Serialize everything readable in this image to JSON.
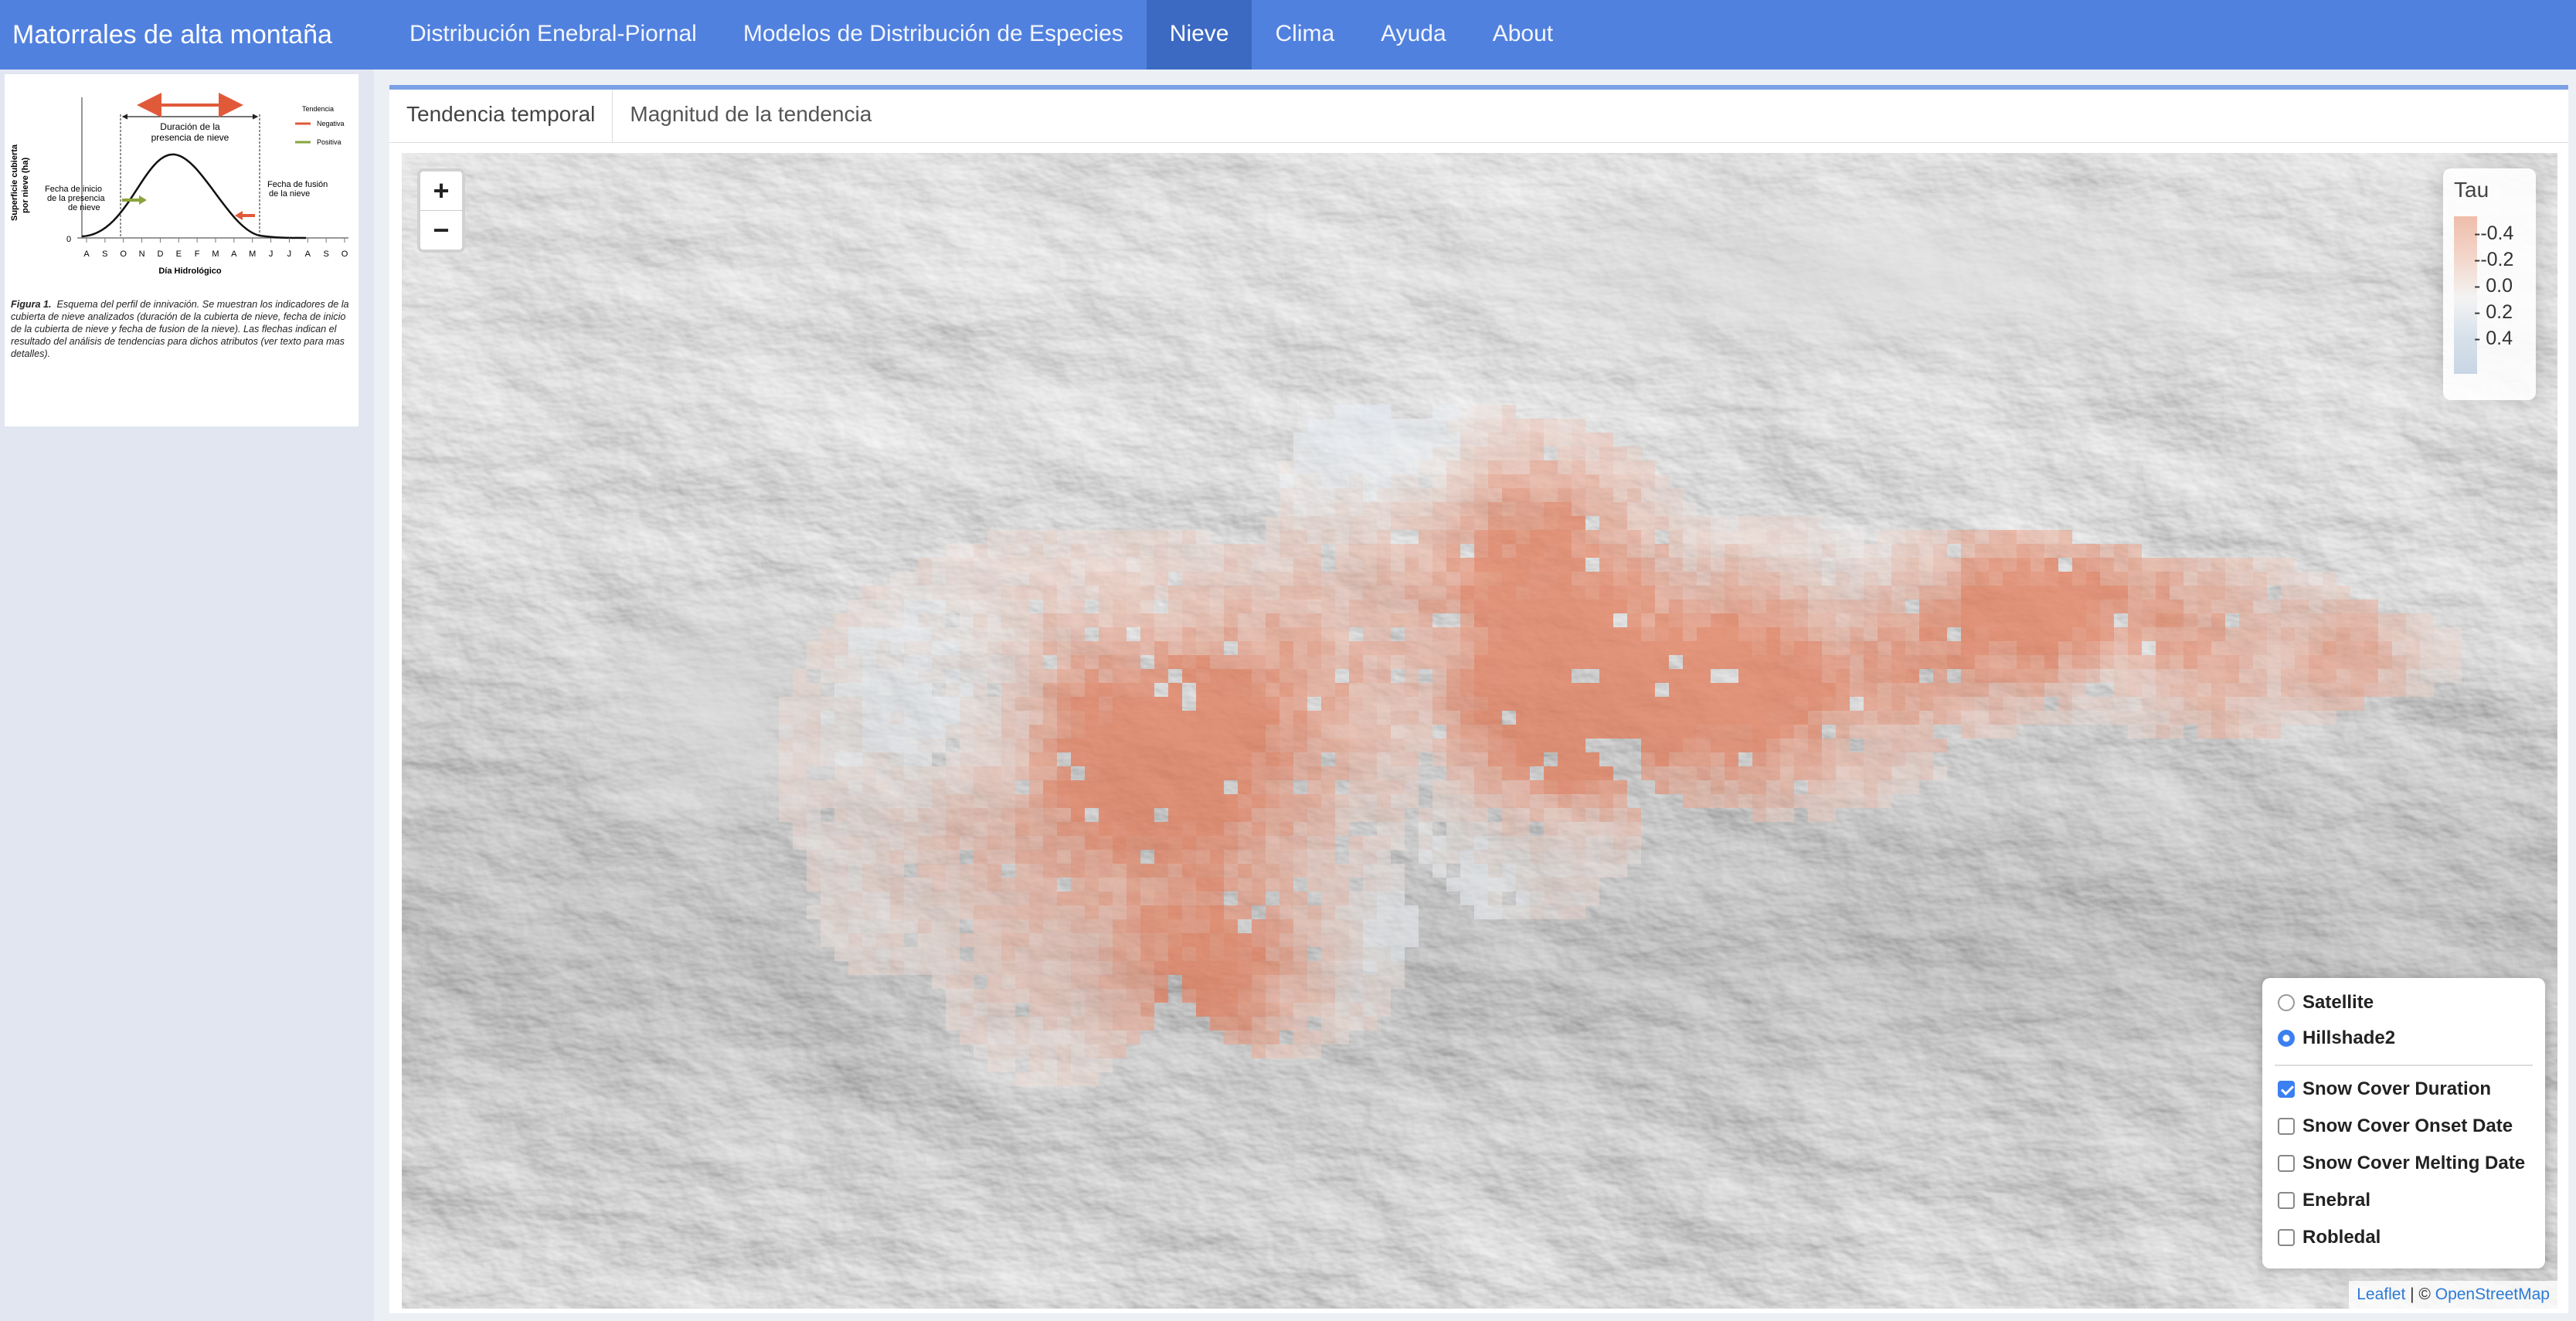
{
  "app": {
    "title": "Matorrales de alta montaña",
    "nav": [
      {
        "label": "Distribución Enebral-Piornal",
        "active": false
      },
      {
        "label": "Modelos de Distribución de Especies",
        "active": false
      },
      {
        "label": "Nieve",
        "active": true
      },
      {
        "label": "Clima",
        "active": false
      },
      {
        "label": "Ayuda",
        "active": false
      },
      {
        "label": "About",
        "active": false
      }
    ]
  },
  "sidebar": {
    "figure": {
      "ylabel_1": "Superficie cubierta",
      "ylabel_2": "por nieve (ha)",
      "y_zero": "0",
      "duration_1": "Duración de la",
      "duration_2": "presencia de nieve",
      "onset_1": "Fecha de inicio",
      "onset_2": "de la presencia",
      "onset_3": "de nieve",
      "melt_1": "Fecha de fusión",
      "melt_2": "de la nieve",
      "legend_title": "Tendencia",
      "legend_neg": "Negativa",
      "legend_pos": "Positiva",
      "months": [
        "A",
        "S",
        "O",
        "N",
        "D",
        "E",
        "F",
        "M",
        "A",
        "M",
        "J",
        "J",
        "A",
        "S",
        "O"
      ],
      "xlabel": "Día Hidrológico",
      "caption_label": "Figura 1.",
      "caption_text": "Esquema del perfil de innivación. Se muestran los indicadores de la cubierta de nieve analizados (duración de la cubierta de nieve, fecha de inicio de la cubierta de nieve y fecha de fusion de la nieve). Las flechas indican el resultado del análisis de tendencias para dichos atributos (ver texto para mas detalles)."
    }
  },
  "main": {
    "tabs": [
      {
        "label": "Tendencia temporal",
        "active": true
      },
      {
        "label": "Magnitud de la tendencia",
        "active": false
      }
    ],
    "map": {
      "zoom_in": "+",
      "zoom_out": "−",
      "legend": {
        "title": "Tau",
        "labels": [
          "-0.4",
          "-0.2",
          "0.0",
          "0.2",
          "0.4"
        ],
        "colors": [
          "#efbdaa",
          "#f3d8cd",
          "#f3f3f3",
          "#d6e0ea",
          "#c9d6e4"
        ]
      },
      "base_layers": [
        {
          "label": "Satellite",
          "selected": false
        },
        {
          "label": "Hillshade2",
          "selected": true
        }
      ],
      "overlays": [
        {
          "label": "Snow Cover Duration",
          "checked": true
        },
        {
          "label": "Snow Cover Onset Date",
          "checked": false
        },
        {
          "label": "Snow Cover Melting Date",
          "checked": false
        },
        {
          "label": "Enebral",
          "checked": false
        },
        {
          "label": "Robledal",
          "checked": false
        }
      ],
      "attribution": {
        "leaflet": "Leaflet",
        "separator": " | © ",
        "osm": "OpenStreetMap"
      }
    }
  },
  "colors": {
    "navbar": "#5181de",
    "navbar_active": "#3c69c2",
    "sidebar": "#e1e6f1",
    "tab_accent": "#7ba0e6",
    "negative_trend": "#e2795a",
    "positive_trend": "#c9d6e4"
  }
}
